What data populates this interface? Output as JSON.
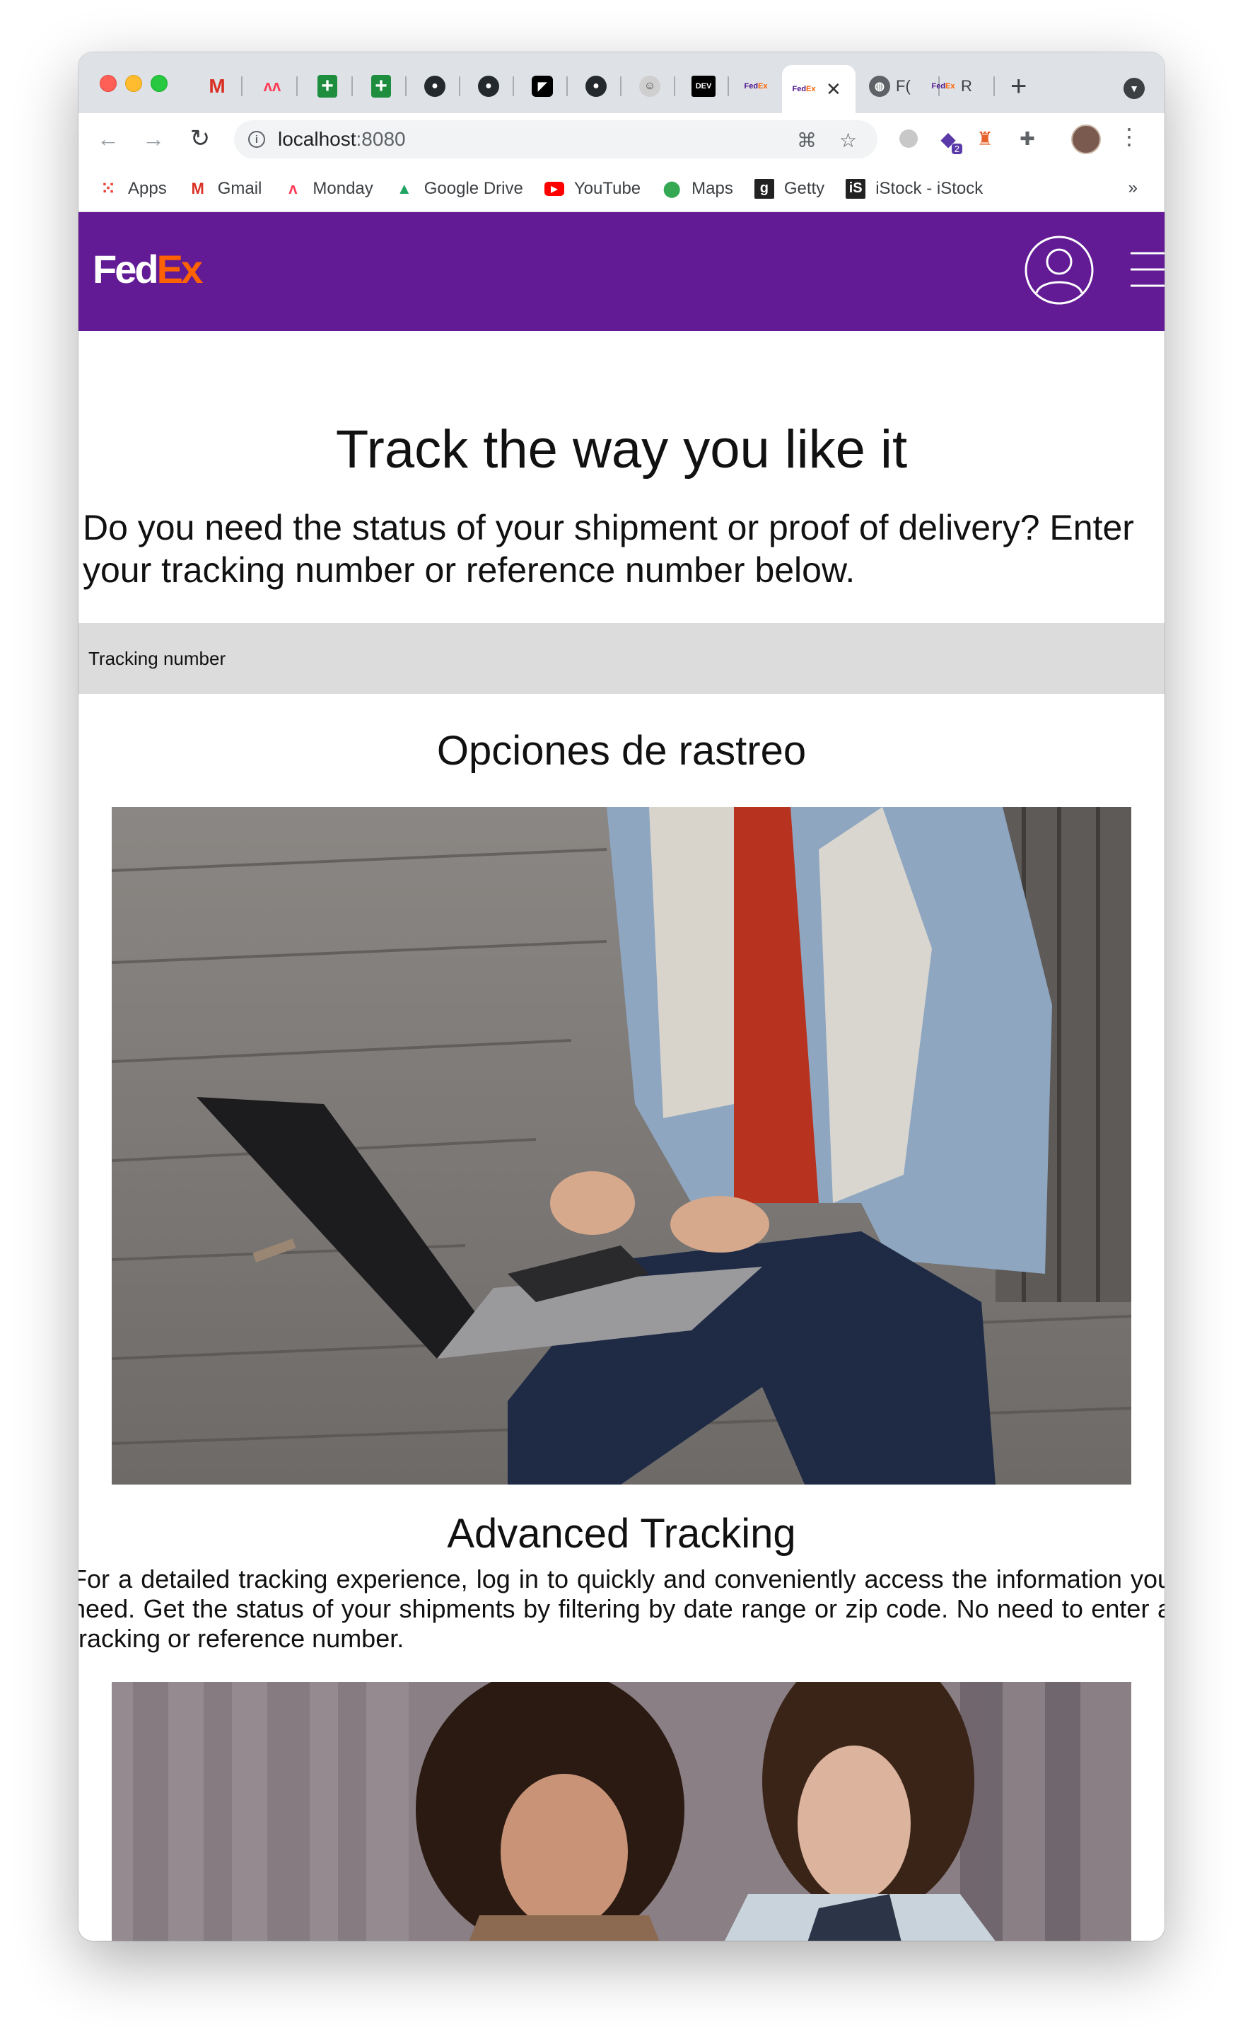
{
  "browser": {
    "tabs": [
      {
        "favicon": "gmail-icon"
      },
      {
        "favicon": "monday-icon"
      },
      {
        "favicon": "sheets-icon"
      },
      {
        "favicon": "sheets-icon"
      },
      {
        "favicon": "github-icon"
      },
      {
        "favicon": "github-icon"
      },
      {
        "favicon": "bird-icon"
      },
      {
        "favicon": "github-icon"
      },
      {
        "favicon": "person-icon"
      },
      {
        "favicon": "dev-icon",
        "label": "DEV"
      },
      {
        "favicon": "fedex-icon"
      }
    ],
    "active_tab": {
      "favicon": "fedex-icon"
    },
    "trailing_tabs": [
      {
        "favicon": "globe-icon",
        "label": "F("
      },
      {
        "favicon": "fedex-icon",
        "label": "R"
      }
    ],
    "url_host": "localhost",
    "url_port": ":8080",
    "extensions_badge": "2",
    "bookmarks": [
      {
        "label": "Apps",
        "icon": "apps-grid-icon"
      },
      {
        "label": "Gmail",
        "icon": "gmail-icon"
      },
      {
        "label": "Monday",
        "icon": "monday-icon"
      },
      {
        "label": "Google Drive",
        "icon": "drive-icon"
      },
      {
        "label": "YouTube",
        "icon": "youtube-icon"
      },
      {
        "label": "Maps",
        "icon": "maps-icon"
      },
      {
        "label": "Getty",
        "icon": "getty-icon"
      },
      {
        "label": "iStock - iStock",
        "icon": "istock-icon"
      }
    ],
    "bookmarks_more": "»"
  },
  "page": {
    "brand_colors": {
      "purple": "#621a95",
      "orange": "#ff6200"
    },
    "logo": {
      "fed": "Fed",
      "ex": "Ex",
      "reg": "."
    },
    "title": "Track the way you like it",
    "intro": "Do you need the status of your shipment or proof of delivery? Enter your tracking number or reference number below.",
    "tracking_placeholder": "Tracking number",
    "options_heading": "Opciones de rastreo",
    "advanced_heading": "Advanced Tracking",
    "advanced_text": "For a detailed tracking experience, log in to quickly and conveniently access the information you need. Get the status of your shipments by filtering by date range or zip code. No need to enter a tracking or reference number."
  }
}
